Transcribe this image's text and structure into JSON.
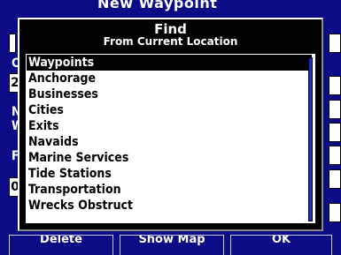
{
  "background_page": {
    "title": "New Waypoint",
    "letters": [
      "C",
      "N",
      "W",
      "F"
    ],
    "boxes": [
      "2",
      "0"
    ],
    "buttons": [
      "Delete",
      "Show Map",
      "OK"
    ]
  },
  "dialog": {
    "title": "Find",
    "subtitle": "From Current Location",
    "items": [
      {
        "label": "Waypoints",
        "selected": true
      },
      {
        "label": "Anchorage",
        "selected": false
      },
      {
        "label": "Businesses",
        "selected": false
      },
      {
        "label": "Cities",
        "selected": false
      },
      {
        "label": "Exits",
        "selected": false
      },
      {
        "label": "Navaids",
        "selected": false
      },
      {
        "label": "Marine Services",
        "selected": false
      },
      {
        "label": "Tide Stations",
        "selected": false
      },
      {
        "label": "Transportation",
        "selected": false
      },
      {
        "label": "Wrecks Obstruct",
        "selected": false
      }
    ]
  },
  "colors": {
    "background": "#0c0c86",
    "selection": "#000000",
    "scroll_thumb": "#1c2cd0"
  }
}
